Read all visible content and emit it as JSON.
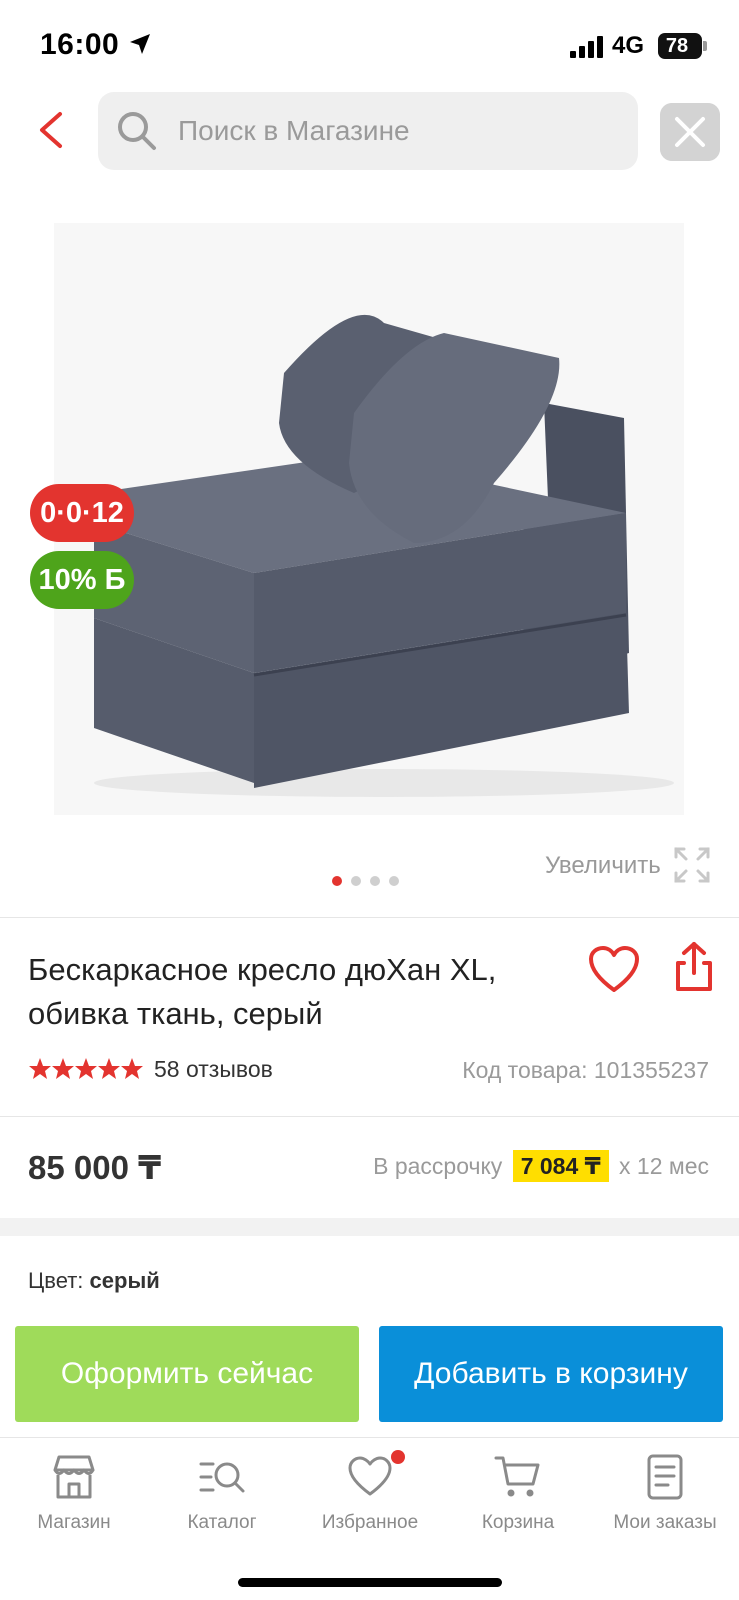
{
  "status_bar": {
    "time": "16:00",
    "network": "4G",
    "battery": "78"
  },
  "search": {
    "placeholder": "Поиск в Магазине"
  },
  "gallery": {
    "badge_installment": "0·0·12",
    "badge_bonus": "10% Б",
    "zoom_label": "Увеличить",
    "slides_total": 4,
    "slide_active": 1
  },
  "product": {
    "title_line1": "Бескаркасное кресло дюХан XL,",
    "title_line2": "обивка ткань, серый",
    "rating": 5,
    "reviews": "58 отзывов",
    "code": "Код товара: 101355237",
    "price": "85 000 ₸",
    "installment_prefix": "В рассрочку",
    "installment_amount": "7 084 ₸",
    "installment_suffix": "х 12 мес",
    "color_label": "Цвет:",
    "color_value": "серый"
  },
  "actions": {
    "buy_now": "Оформить сейчас",
    "add_to_cart": "Добавить в корзину"
  },
  "bottom_nav": [
    {
      "label": "Магазин",
      "icon": "shop-icon"
    },
    {
      "label": "Каталог",
      "icon": "catalog-search-icon"
    },
    {
      "label": "Избранное",
      "icon": "heart-icon"
    },
    {
      "label": "Корзина",
      "icon": "cart-icon"
    },
    {
      "label": "Мои заказы",
      "icon": "orders-icon"
    }
  ],
  "colors": {
    "accent_red": "#e3342f",
    "buy_green": "#9fdb5a",
    "cart_blue": "#0a8fd9",
    "bonus_green": "#4ea41b",
    "highlight_yellow": "#ffde00"
  }
}
